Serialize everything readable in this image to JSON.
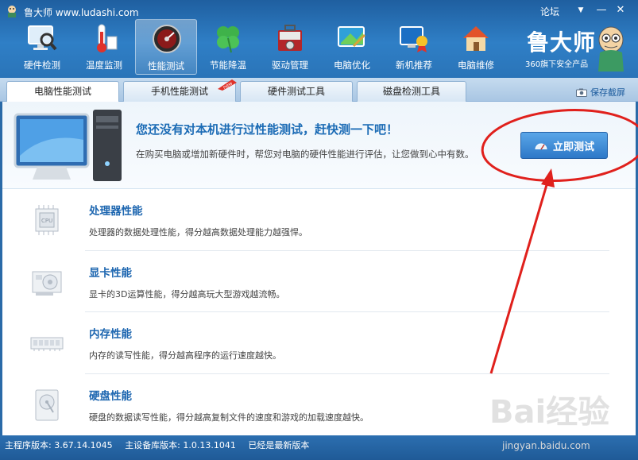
{
  "window": {
    "title": "鲁大师 www.ludashi.com",
    "forum_link": "论坛",
    "menu_glyph": "▼",
    "minimize_glyph": "—",
    "close_glyph": "✕"
  },
  "nav": [
    {
      "label": "硬件检测",
      "icon": "monitor-magnifier-icon",
      "active": false
    },
    {
      "label": "温度监测",
      "icon": "thermometer-icon",
      "active": false
    },
    {
      "label": "性能测试",
      "icon": "speedometer-icon",
      "active": true
    },
    {
      "label": "节能降温",
      "icon": "clover-icon",
      "active": false
    },
    {
      "label": "驱动管理",
      "icon": "toolbox-icon",
      "active": false
    },
    {
      "label": "电脑优化",
      "icon": "screen-brush-icon",
      "active": false
    },
    {
      "label": "新机推荐",
      "icon": "monitor-award-icon",
      "active": false
    },
    {
      "label": "电脑维修",
      "icon": "house-icon",
      "active": false
    }
  ],
  "brand": {
    "name": "鲁大师",
    "subtitle": "360旗下安全产品"
  },
  "tabs": [
    {
      "label": "电脑性能测试",
      "active": true
    },
    {
      "label": "手机性能测试",
      "active": false,
      "badge": "new"
    },
    {
      "label": "硬件测试工具",
      "active": false
    },
    {
      "label": "磁盘检测工具",
      "active": false
    }
  ],
  "save_screenshot": "保存截屏",
  "banner": {
    "title": "您还没有对本机进行过性能测试，赶快测一下吧！",
    "description": "在购买电脑或增加新硬件时，帮您对电脑的硬件性能进行评估，让您做到心中有数。",
    "button_label": "立即测试"
  },
  "perf_items": [
    {
      "title": "处理器性能",
      "description": "处理器的数据处理性能，得分越高数据处理能力越强悍。",
      "icon": "cpu-icon"
    },
    {
      "title": "显卡性能",
      "description": "显卡的3D运算性能，得分越高玩大型游戏越流畅。",
      "icon": "graphics-card-icon"
    },
    {
      "title": "内存性能",
      "description": "内存的读写性能，得分越高程序的运行速度越快。",
      "icon": "memory-icon"
    },
    {
      "title": "硬盘性能",
      "description": "硬盘的数据读写性能，得分越高复制文件的速度和游戏的加载速度越快。",
      "icon": "hard-disk-icon"
    }
  ],
  "status": {
    "main_version": "主程序版本: 3.67.14.1045",
    "db_version": "主设备库版本: 1.0.13.1041",
    "latest": "已经是最新版本"
  },
  "watermark": {
    "logo_text": "Bai经验",
    "url": "jingyan.baidu.com"
  },
  "colors": {
    "annotation_red": "#e0201c",
    "accent_blue": "#1d66b0"
  }
}
